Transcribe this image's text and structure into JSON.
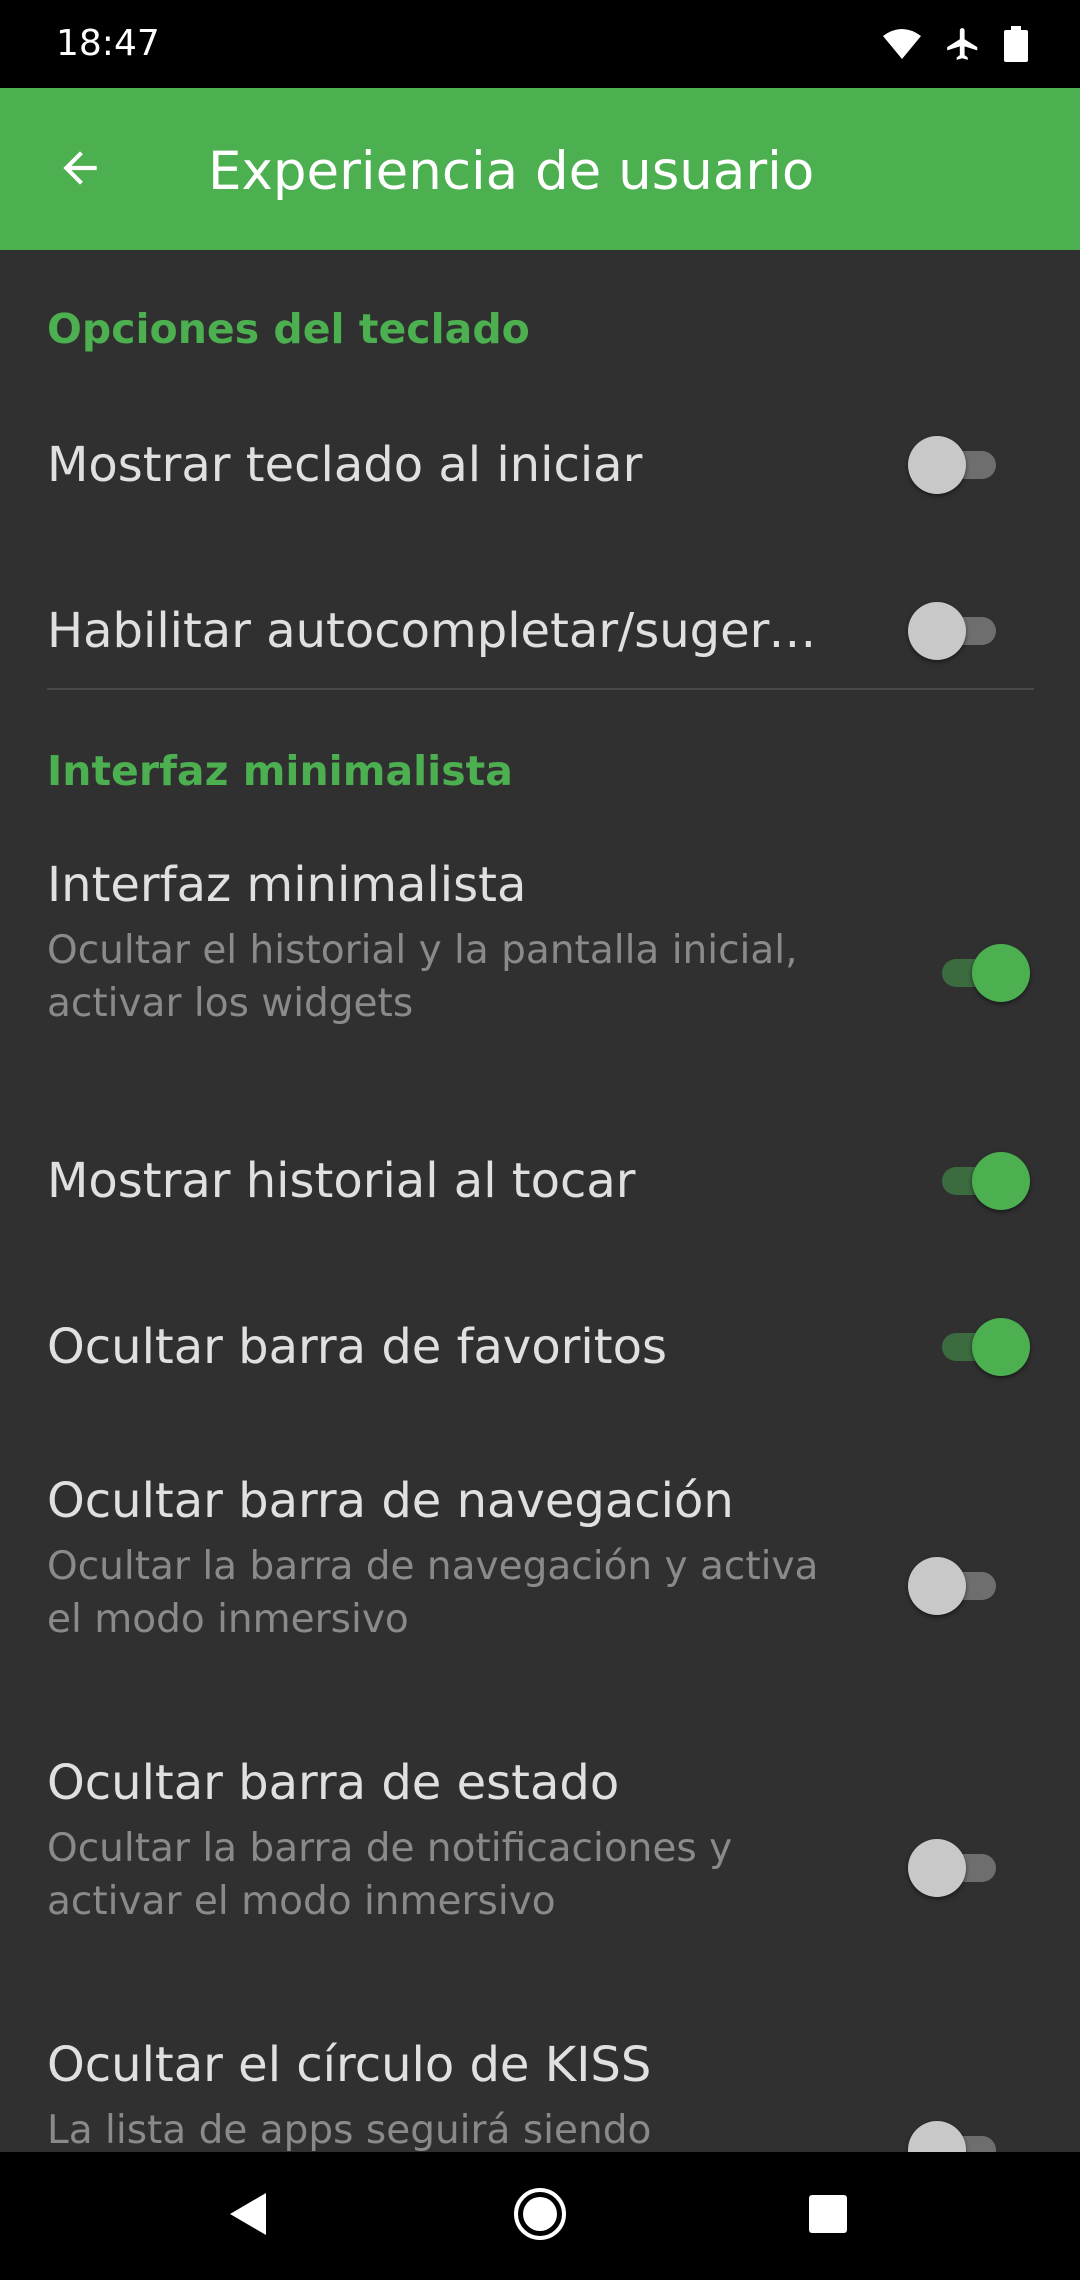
{
  "status_bar": {
    "time": "18:47",
    "icons": [
      "wifi-icon",
      "airplane-mode-icon",
      "battery-icon"
    ]
  },
  "app_bar": {
    "title": "Experiencia de usuario",
    "back_icon": "arrow-left-icon"
  },
  "colors": {
    "accent": "#4caf50",
    "background": "#303030",
    "title_text": "#e0e0e0",
    "summary_text": "#8a8a8a"
  },
  "sections": [
    {
      "title": "Opciones del teclado",
      "items": [
        {
          "title": "Mostrar teclado al iniciar",
          "summary": "",
          "checked": false
        },
        {
          "title": "Habilitar autocompletar/sugerencias",
          "summary": "",
          "checked": false
        }
      ]
    },
    {
      "title": "Interfaz minimalista",
      "items": [
        {
          "title": "Interfaz minimalista",
          "summary": "Ocultar el historial y la pantalla inicial, activar los widgets",
          "checked": true
        },
        {
          "title": "Mostrar historial al tocar",
          "summary": "",
          "checked": true
        },
        {
          "title": "Ocultar barra de favoritos",
          "summary": "",
          "checked": true
        },
        {
          "title": "Ocultar barra de navegación",
          "summary": "Ocultar la barra de navegación y activa el modo inmersivo",
          "checked": false
        },
        {
          "title": "Ocultar barra de estado",
          "summary": "Ocultar la barra de notificaciones y activar el modo inmersivo",
          "checked": false
        },
        {
          "title": "Ocultar el círculo de KISS",
          "summary": "La lista de apps seguirá siendo",
          "checked": false
        }
      ]
    }
  ],
  "nav_bar": {
    "icons": [
      "back-triangle-icon",
      "home-circle-icon",
      "recents-square-icon"
    ]
  }
}
